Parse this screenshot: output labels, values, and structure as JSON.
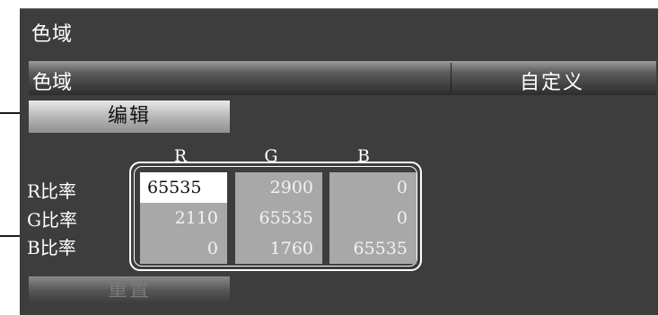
{
  "panel": {
    "title": "色域"
  },
  "gamut_row": {
    "label": "色域",
    "value": "自定义"
  },
  "buttons": {
    "edit": "编辑",
    "reset": "重置"
  },
  "matrix": {
    "columns": [
      "R",
      "G",
      "B"
    ],
    "rows": [
      {
        "label": "R比率",
        "values": [
          "65535",
          "2900",
          "0"
        ]
      },
      {
        "label": "G比率",
        "values": [
          "2110",
          "65535",
          "0"
        ]
      },
      {
        "label": "B比率",
        "values": [
          "0",
          "1760",
          "65535"
        ]
      }
    ],
    "active_cell": "R比率/R"
  },
  "colors": {
    "panel_bg": "#3d3d3d",
    "cell_bg": "#a8a8a8",
    "active_cell_bg": "#ffffff",
    "text": "#ffffff"
  }
}
